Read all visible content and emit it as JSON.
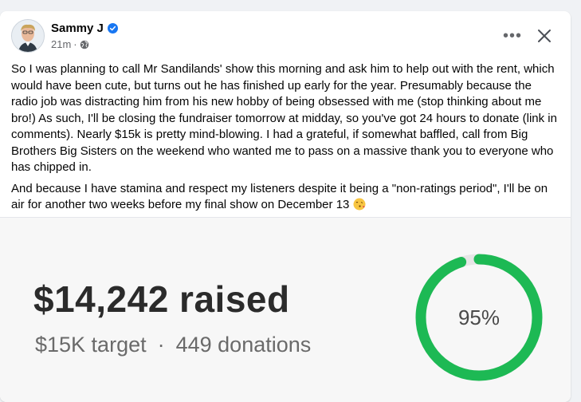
{
  "post": {
    "author": "Sammy J",
    "time": "21m",
    "separator": "·",
    "paragraphs": [
      "So I was planning to call Mr Sandilands' show this morning and ask him to help out with the rent, which would have been cute, but turns out he has finished up early for the year. Presumably because the radio job was distracting him from his new hobby of being obsessed with me (stop thinking about me bro!) As such, I'll be closing the fundraiser tomorrow at midday, so you've got 24 hours to donate (link in comments). Nearly $15k is pretty mind-blowing. I had a grateful, if somewhat baffled, call from Big Brothers Big Sisters on the weekend who wanted me to pass on a massive thank you to everyone who has chipped in.",
      "And because I have stamina and respect my listeners despite it being a \"non-ratings period\", I'll be on air for another two weeks before my final show on December 13"
    ],
    "emoji": "face-blowing-kiss-icon"
  },
  "actions": {
    "more_label": "•••"
  },
  "fundraiser": {
    "raised": "$14,242 raised",
    "target": "$15K target",
    "separator": "·",
    "donations": "449 donations",
    "percent_label": "95%",
    "progress": 0.95,
    "ring_color": "#1db954",
    "track_color": "#e6e6e6"
  },
  "colors": {
    "verified": "#1877f2",
    "meta": "#65676b"
  }
}
